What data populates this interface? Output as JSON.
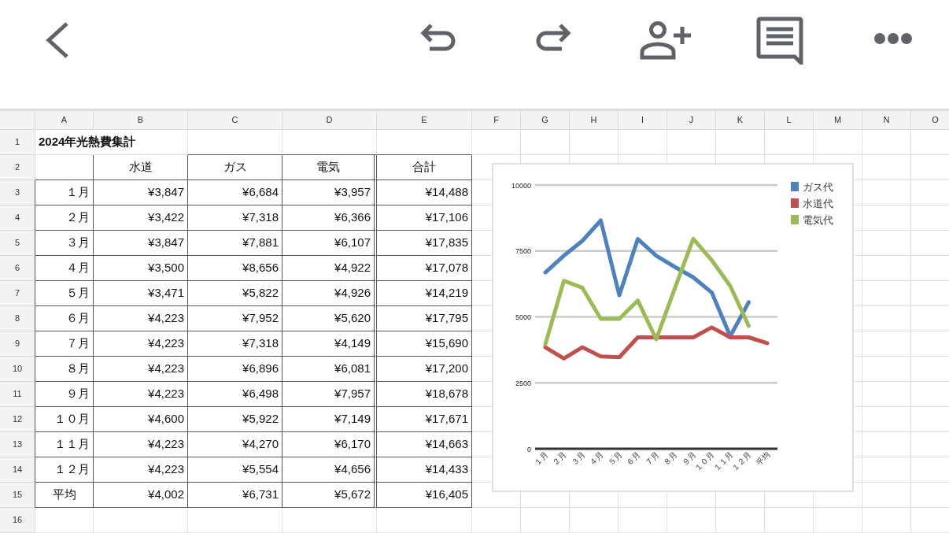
{
  "sheet": {
    "column_headers": [
      "A",
      "B",
      "C",
      "D",
      "E",
      "F",
      "G",
      "H",
      "I",
      "J",
      "K",
      "L",
      "M",
      "N",
      "O"
    ],
    "row_numbers": [
      "1",
      "2",
      "3",
      "4",
      "5",
      "6",
      "7",
      "8",
      "9",
      "10",
      "11",
      "12",
      "13",
      "14",
      "15",
      "16"
    ],
    "title": "2024年光熱費集計",
    "table": {
      "header": [
        "水道",
        "ガス",
        "電気",
        "合計"
      ],
      "rows": [
        {
          "label": "１月",
          "values": [
            "¥3,847",
            "¥6,684",
            "¥3,957",
            "¥14,488"
          ]
        },
        {
          "label": "２月",
          "values": [
            "¥3,422",
            "¥7,318",
            "¥6,366",
            "¥17,106"
          ]
        },
        {
          "label": "３月",
          "values": [
            "¥3,847",
            "¥7,881",
            "¥6,107",
            "¥17,835"
          ]
        },
        {
          "label": "４月",
          "values": [
            "¥3,500",
            "¥8,656",
            "¥4,922",
            "¥17,078"
          ]
        },
        {
          "label": "５月",
          "values": [
            "¥3,471",
            "¥5,822",
            "¥4,926",
            "¥14,219"
          ]
        },
        {
          "label": "６月",
          "values": [
            "¥4,223",
            "¥7,952",
            "¥5,620",
            "¥17,795"
          ]
        },
        {
          "label": "７月",
          "values": [
            "¥4,223",
            "¥7,318",
            "¥4,149",
            "¥15,690"
          ]
        },
        {
          "label": "８月",
          "values": [
            "¥4,223",
            "¥6,896",
            "¥6,081",
            "¥17,200"
          ]
        },
        {
          "label": "９月",
          "values": [
            "¥4,223",
            "¥6,498",
            "¥7,957",
            "¥18,678"
          ]
        },
        {
          "label": "１０月",
          "values": [
            "¥4,600",
            "¥5,922",
            "¥7,149",
            "¥17,671"
          ]
        },
        {
          "label": "１１月",
          "values": [
            "¥4,223",
            "¥4,270",
            "¥6,170",
            "¥14,663"
          ]
        },
        {
          "label": "１２月",
          "values": [
            "¥4,223",
            "¥5,554",
            "¥4,656",
            "¥14,433"
          ]
        }
      ],
      "footer": {
        "label": "平均",
        "values": [
          "¥4,002",
          "¥6,731",
          "¥5,672",
          "¥16,405"
        ]
      }
    },
    "chart": {
      "chart_data": {
        "type": "line",
        "categories": [
          "１月",
          "２月",
          "３月",
          "４月",
          "５月",
          "６月",
          "７月",
          "８月",
          "９月",
          "１０月",
          "１１月",
          "１２月",
          "平均"
        ],
        "series": [
          {
            "name": "ガス代",
            "color": "#4f81bd",
            "values": [
              6684,
              7318,
              7881,
              8656,
              5822,
              7952,
              7318,
              6896,
              6498,
              5922,
              4270,
              5554,
              null
            ]
          },
          {
            "name": "水道代",
            "color": "#c0504d",
            "values": [
              3847,
              3422,
              3847,
              3500,
              3471,
              4223,
              4223,
              4223,
              4223,
              4600,
              4223,
              4223,
              4002
            ]
          },
          {
            "name": "電気代",
            "color": "#9bbb59",
            "values": [
              3957,
              6366,
              6107,
              4922,
              4926,
              5620,
              4149,
              6081,
              7957,
              7149,
              6170,
              4656,
              null
            ]
          }
        ],
        "ylim": [
          0,
          10000
        ],
        "yticks": [
          0,
          2500,
          5000,
          7500,
          10000
        ],
        "grid": true,
        "legend": true
      }
    }
  }
}
